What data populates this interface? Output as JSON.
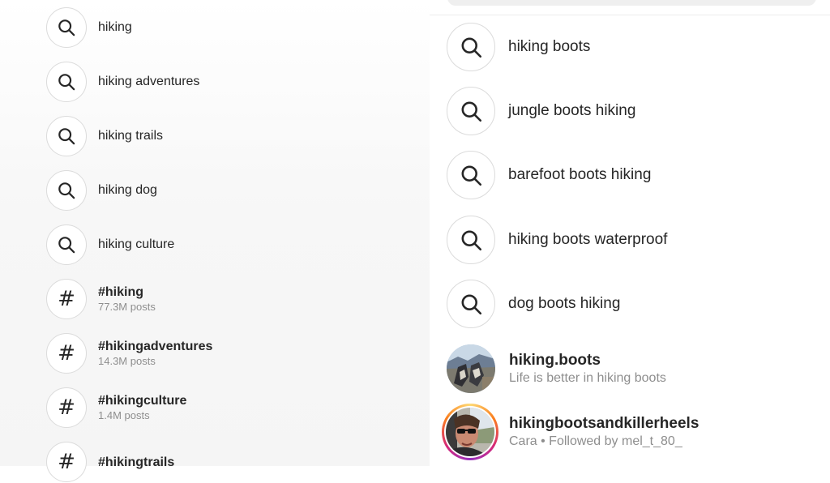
{
  "left_suggestions": [
    {
      "label": "hiking",
      "icon": "search-icon"
    },
    {
      "label": "hiking adventures",
      "icon": "search-icon"
    },
    {
      "label": "hiking trails",
      "icon": "search-icon"
    },
    {
      "label": "hiking dog",
      "icon": "search-icon"
    },
    {
      "label": "hiking culture",
      "icon": "search-icon"
    }
  ],
  "hashtags": [
    {
      "tag": "#hiking",
      "posts": "77.3M posts"
    },
    {
      "tag": "#hikingadventures",
      "posts": "14.3M posts"
    },
    {
      "tag": "#hikingculture",
      "posts": "1.4M posts"
    },
    {
      "tag": "#hikingtrails",
      "posts": ""
    }
  ],
  "right_suggestions": [
    {
      "label": "hiking boots",
      "icon": "search-icon"
    },
    {
      "label": "jungle boots hiking",
      "icon": "search-icon"
    },
    {
      "label": "barefoot boots hiking",
      "icon": "search-icon"
    },
    {
      "label": "hiking boots waterproof",
      "icon": "search-icon"
    },
    {
      "label": "dog boots hiking",
      "icon": "search-icon"
    }
  ],
  "accounts": [
    {
      "username": "hiking.boots",
      "subtitle": "Life is better in hiking boots",
      "has_story": false
    },
    {
      "username": "hikingbootsandkillerheels",
      "subtitle": "Cara • Followed by mel_t_80_",
      "has_story": true
    }
  ],
  "colors": {
    "text": "#262626",
    "secondary_text": "#8e8e8e",
    "icon_border": "#dbdbdb",
    "story_ring": [
      "#feda75",
      "#fa7e1e",
      "#d62976",
      "#962fbf"
    ]
  }
}
